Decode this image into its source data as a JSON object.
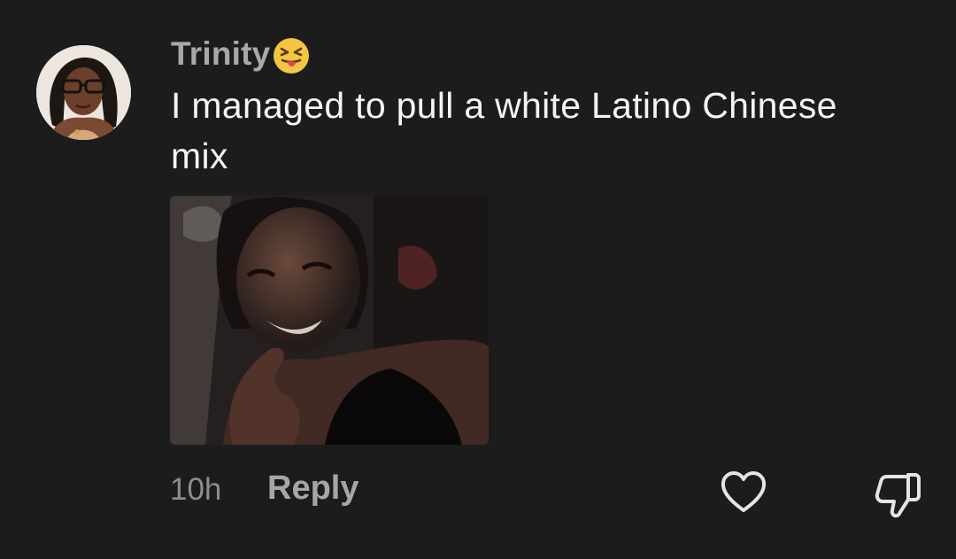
{
  "comment": {
    "username": "Trinity",
    "username_emoji": "squinting-face-with-tongue",
    "text": "I managed to pull a white Latino Chinese mix",
    "timestamp": "10h",
    "reply_label": "Reply",
    "attachment": "photo"
  },
  "icons": {
    "like": "heart-outline-icon",
    "dislike": "thumbs-down-outline-icon"
  },
  "colors": {
    "background": "#1c1c1d",
    "username": "#a9a9ac",
    "comment_text": "#f4f4f5",
    "secondary_text": "#8e8e92",
    "icon_stroke": "#e5e5e7"
  }
}
